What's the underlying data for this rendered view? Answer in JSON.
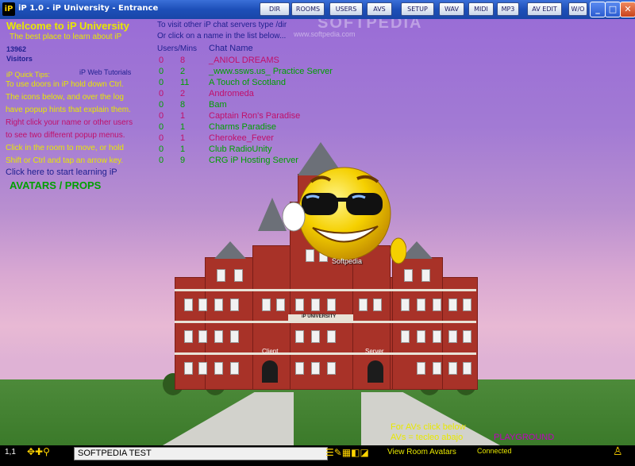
{
  "window": {
    "title": "iP 1.0 - iP University - Entrance",
    "app_icon_text": "iP",
    "minimize": "_",
    "maximize": "□",
    "close": "✕"
  },
  "menu": [
    "DIR",
    "ROOMS",
    "USERS",
    "AVS",
    "SETUP",
    "WAV",
    "MIDI",
    "MP3",
    "AV EDIT",
    "W/O"
  ],
  "watermark": "SOFTPEDIA",
  "watermark_url": "www.softpedia.com",
  "left_panel": {
    "welcome": "Welcome to iP University",
    "tagline": "The best place to learn about iP",
    "visitor_count": "13962",
    "visitors_label": "Visitors",
    "quick_tips_label": "iP Quick Tips:",
    "web_tutorials_link": "iP Web Tutorials",
    "tips": [
      "To use doors in iP hold down Ctrl.",
      "The icons below, and over the log",
      "have popup hints that explain them.",
      "Right click your name or other users",
      "to see two different popup menus.",
      "Click in the room to move, or hold",
      "Shift or Ctrl and tap an arrow key."
    ],
    "start_learning": "Click here to start learning iP",
    "avatars_props": "AVATARS / PROPS"
  },
  "server_panel": {
    "instruction_1": "To visit other iP chat servers type /dir",
    "instruction_2": "Or click on a name in the list below...",
    "col_users_mins": "Users/Mins",
    "col_chat_name": "Chat Name",
    "servers": [
      {
        "users": "0",
        "mins": "8",
        "name": "_ANIOL DREAMS",
        "color": "#c0106a"
      },
      {
        "users": "0",
        "mins": "2",
        "name": "_www.ssws.us_ Practice Server",
        "color": "#00a000"
      },
      {
        "users": "0",
        "mins": "11",
        "name": "A Touch of Scotland",
        "color": "#00a000"
      },
      {
        "users": "0",
        "mins": "2",
        "name": "Andromeda",
        "color": "#c0106a"
      },
      {
        "users": "0",
        "mins": "8",
        "name": "Bam",
        "color": "#00a000"
      },
      {
        "users": "0",
        "mins": "1",
        "name": "Captain Ron's Paradise",
        "color": "#c0106a"
      },
      {
        "users": "0",
        "mins": "1",
        "name": "Charms Paradise",
        "color": "#00a000"
      },
      {
        "users": "0",
        "mins": "1",
        "name": "Cherokee_Fever",
        "color": "#c0106a"
      },
      {
        "users": "0",
        "mins": "1",
        "name": "Club RadioUnity",
        "color": "#00a000"
      },
      {
        "users": "0",
        "mins": "9",
        "name": "CRG iP Hosting Server",
        "color": "#00a000"
      }
    ]
  },
  "avatar_label": "Softpedia",
  "building": {
    "name": "iP UNIVERSITY",
    "door_client": "Client",
    "door_server": "Server"
  },
  "bottom_right": {
    "line_1": "For AVs click below",
    "line_2": "AVs = tecleo abajo",
    "playground": "PLAYGROUND"
  },
  "statusbar": {
    "coords": "1,1",
    "chat_input_value": "SOFTPEDIA TEST",
    "view_room_avatars": "View Room Avatars",
    "connection_status": "Connected"
  },
  "colors": {
    "yellow_text": "#e8e800",
    "blue_text": "#202090",
    "pink_text": "#c0106a",
    "green_text": "#00a000"
  }
}
